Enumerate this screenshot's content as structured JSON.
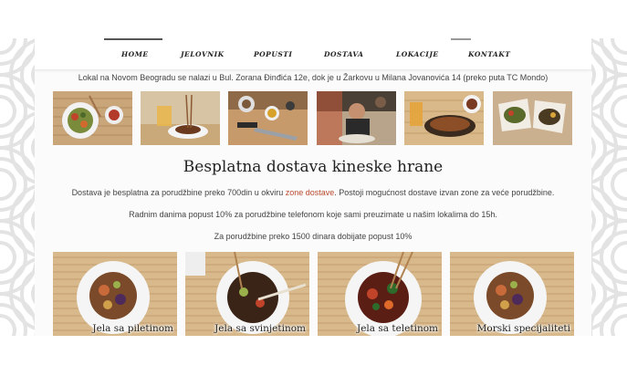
{
  "nav": {
    "items": [
      {
        "label": "HOME"
      },
      {
        "label": "JELOVNIK"
      },
      {
        "label": "POPUSTI"
      },
      {
        "label": "DOSTAVA"
      },
      {
        "label": "LOKACIJE"
      },
      {
        "label": "KONTAKT"
      }
    ]
  },
  "info": {
    "locations": "Lokal na Novom Beogradu se nalazi u Bul. Zorana Đinđića 12e, dok je u Žarkovu u Milana Jovanovića 14 (preko puta TC Mondo)"
  },
  "delivery": {
    "heading": "Besplatna dostava kineske hrane",
    "p1_before": "Dostava je besplatna za porudžbine preko 700din u okviru ",
    "p1_link": "zone dostave",
    "p1_after": ". Postoji mogućnost dostave izvan zone za veće  porudžbine.",
    "p2": "Radnim danima popust 10% za porudžbine telefonom koje sami preuzimate u našim lokalima do 15h.",
    "p3": "Za porudžbine preko 1500 dinara dobijate popust 10%"
  },
  "categories": [
    {
      "label": "Jela sa piletinom"
    },
    {
      "label": "Jela sa svinjetinom"
    },
    {
      "label": "Jela sa teletinom"
    },
    {
      "label": "Morski specijaliteti"
    }
  ],
  "colors": {
    "accent_link": "#b94a2e",
    "mat": "#d8b98c",
    "pattern": "#e4e4e4"
  }
}
